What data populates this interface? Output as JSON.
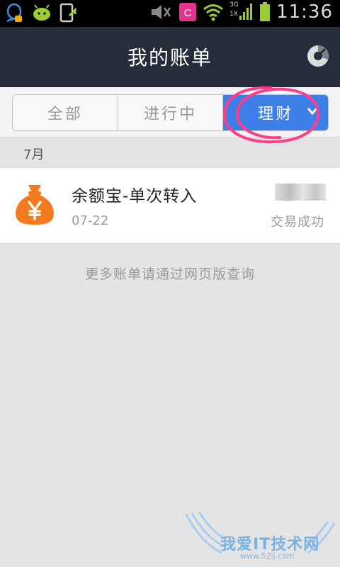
{
  "status_bar": {
    "time": "11:36",
    "network": "3G",
    "network2": "1X",
    "icons": [
      "qq-icon",
      "android-icon",
      "screenshot-icon",
      "mute-icon",
      "app-c-icon",
      "wifi-icon",
      "signal-icon",
      "battery-icon"
    ]
  },
  "header": {
    "title": "我的账单"
  },
  "tabs": [
    {
      "label": "全部",
      "active": false
    },
    {
      "label": "进行中",
      "active": false
    },
    {
      "label": "理财",
      "active": true
    }
  ],
  "month": "7月",
  "bills": [
    {
      "name": "余额宝-单次转入",
      "date": "07-22",
      "status": "交易成功",
      "icon": "money-bag-icon"
    }
  ],
  "more_hint": "更多账单请通过网页版查询",
  "watermark": {
    "text": "我爱IT技术网",
    "url": "www.52ij.com"
  },
  "colors": {
    "header_bg": "#252c3b",
    "active_tab": "#3d7fe6",
    "bag_orange": "#f57a1f",
    "annotation": "#ff3d8b"
  }
}
